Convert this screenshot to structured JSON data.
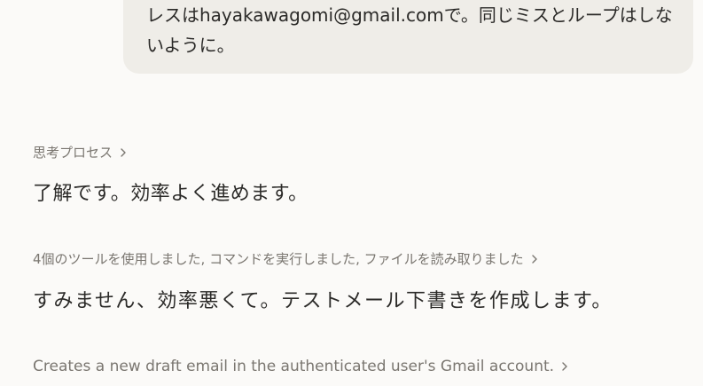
{
  "user_message": {
    "lines": [
      "レスはhayakawagomi@gmail.comで。同じミスとループはしな",
      "いように。"
    ]
  },
  "thinking": {
    "label": "思考プロセス"
  },
  "assistant": {
    "reply_1": "了解です。効率よく進めます。",
    "tool_summary": "4個のツールを使用しました, コマンドを実行しました, ファイルを読み取りました",
    "reply_2": "すみません、効率悪くて。テストメール下書きを作成します。",
    "tool_call_description": "Creates a new draft email in the authenticated user's Gmail account."
  },
  "icons": {
    "expand": "chevron-right-icon"
  },
  "colors": {
    "background": "#fbfaf8",
    "user_bubble": "#efede8",
    "primary_text": "#2b2a28",
    "muted_text": "#7a7670"
  }
}
